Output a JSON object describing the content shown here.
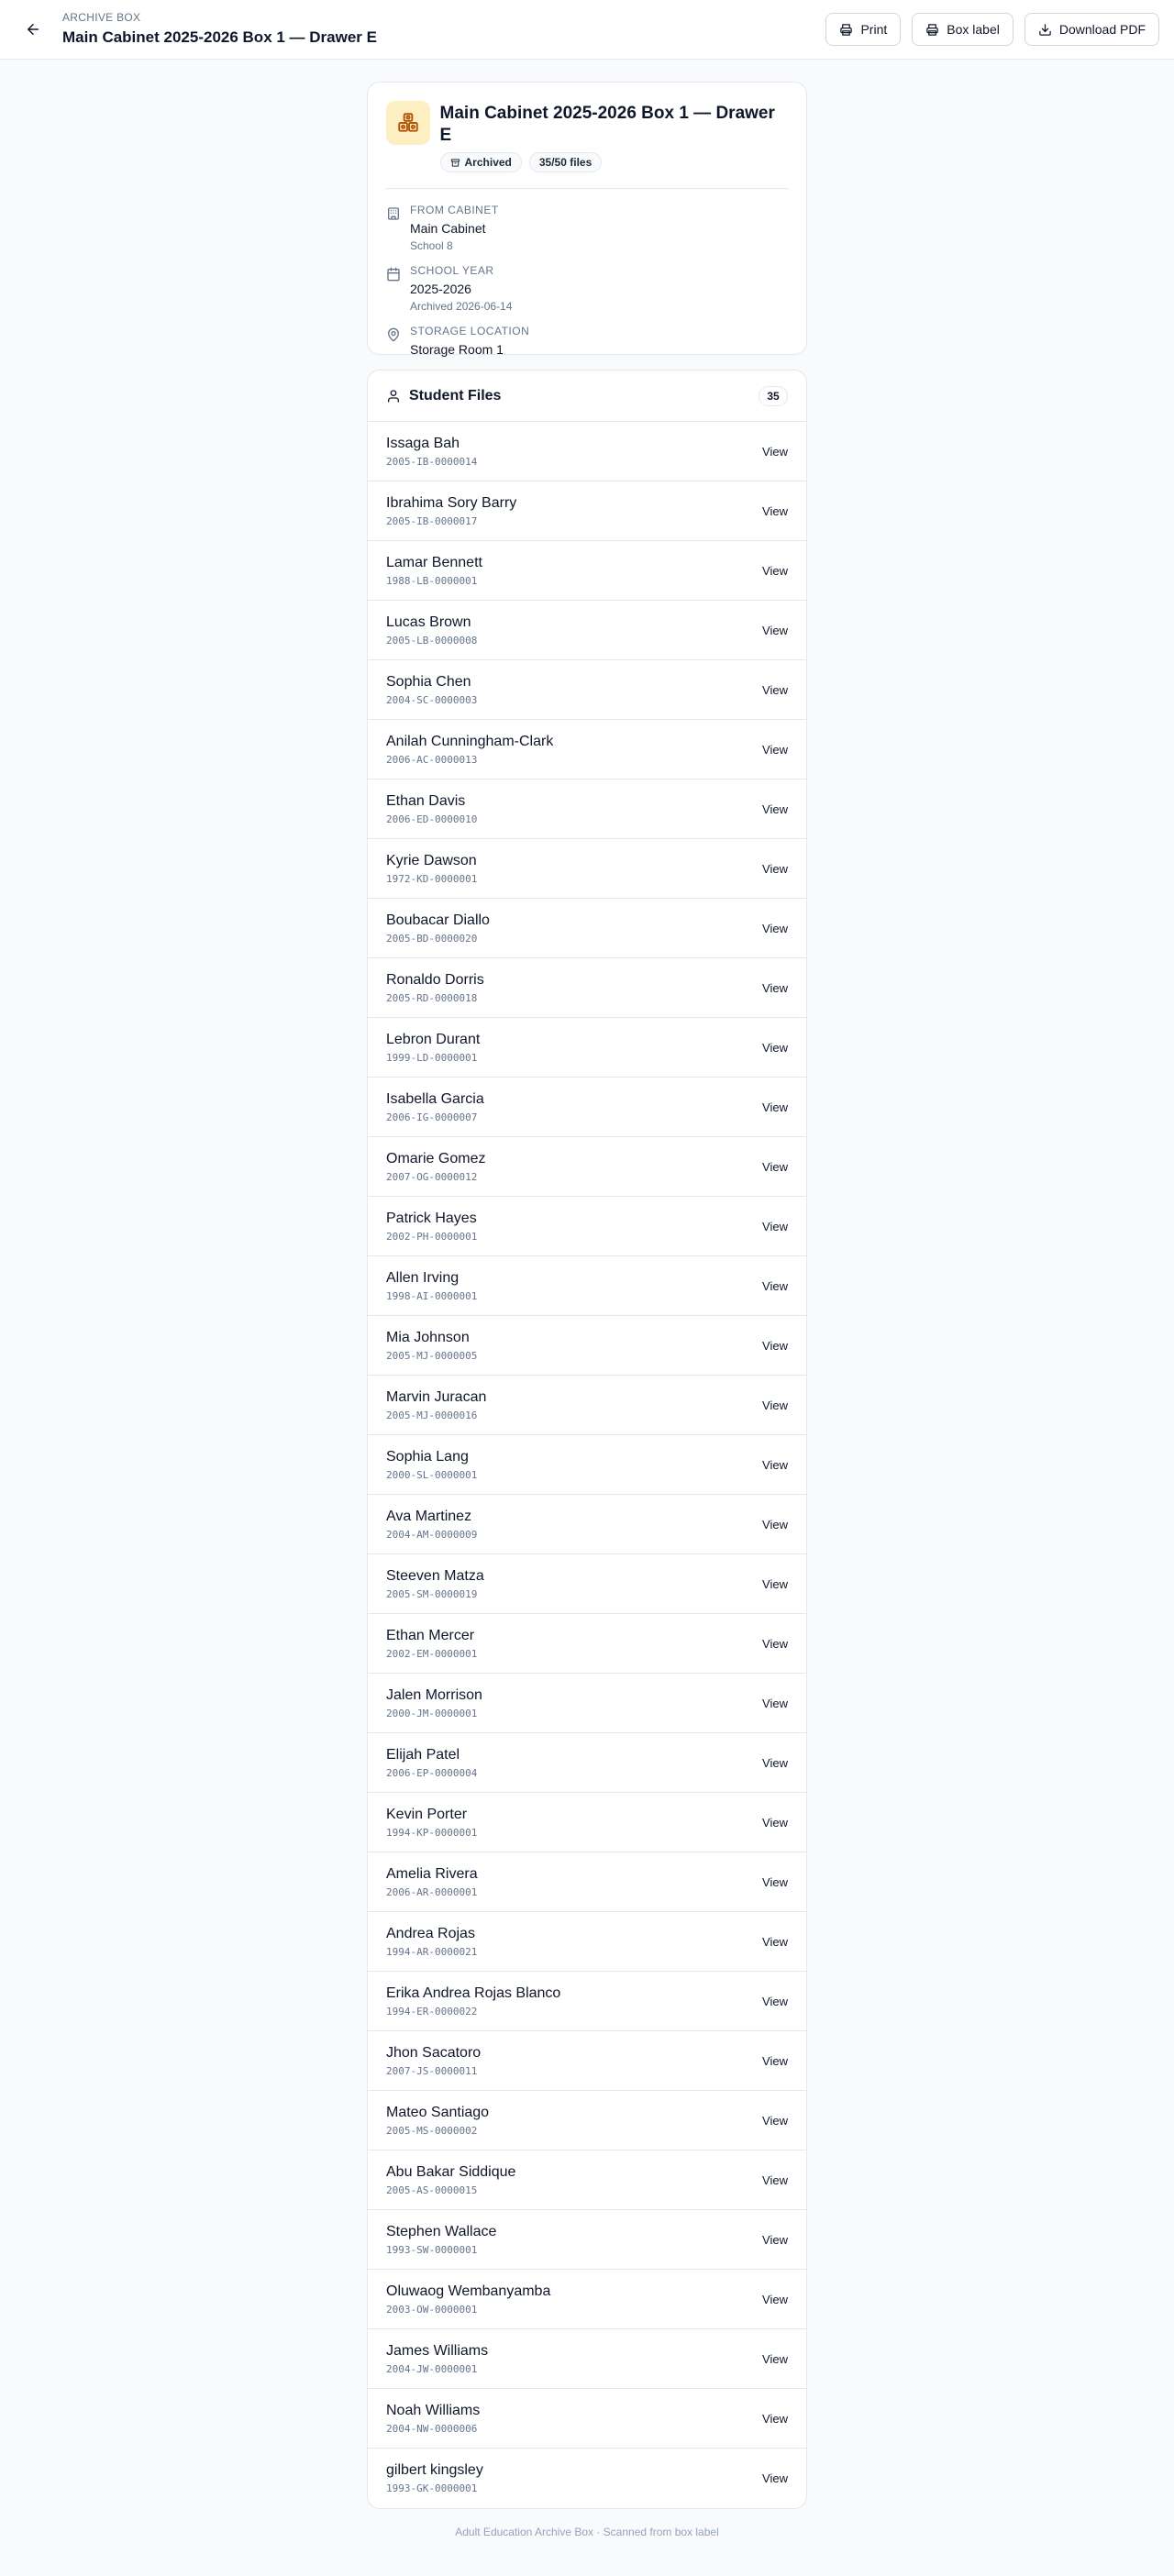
{
  "header": {
    "eyebrow": "ARCHIVE BOX",
    "title": "Main Cabinet 2025-2026 Box 1 — Drawer E",
    "actions": {
      "print": "Print",
      "box_label": "Box label",
      "download_pdf": "Download PDF"
    }
  },
  "box": {
    "title": "Main Cabinet 2025-2026 Box 1 — Drawer E",
    "status_badge": "Archived",
    "files_badge": "35/50 files",
    "meta": {
      "cabinet": {
        "label": "FROM CABINET",
        "value": "Main Cabinet",
        "sub": "School 8"
      },
      "year": {
        "label": "SCHOOL YEAR",
        "value": "2025-2026",
        "sub": "Archived 2026-06-14"
      },
      "location": {
        "label": "STORAGE LOCATION",
        "value": "Storage Room 1"
      }
    }
  },
  "files": {
    "title": "Student Files",
    "count": "35",
    "view_label": "View",
    "items": [
      {
        "name": "Issaga Bah",
        "id": "2005-IB-0000014"
      },
      {
        "name": "Ibrahima Sory Barry",
        "id": "2005-IB-0000017"
      },
      {
        "name": "Lamar Bennett",
        "id": "1988-LB-0000001"
      },
      {
        "name": "Lucas Brown",
        "id": "2005-LB-0000008"
      },
      {
        "name": "Sophia Chen",
        "id": "2004-SC-0000003"
      },
      {
        "name": "Anilah Cunningham-Clark",
        "id": "2006-AC-0000013"
      },
      {
        "name": "Ethan Davis",
        "id": "2006-ED-0000010"
      },
      {
        "name": "Kyrie Dawson",
        "id": "1972-KD-0000001"
      },
      {
        "name": "Boubacar Diallo",
        "id": "2005-BD-0000020"
      },
      {
        "name": "Ronaldo Dorris",
        "id": "2005-RD-0000018"
      },
      {
        "name": "Lebron Durant",
        "id": "1999-LD-0000001"
      },
      {
        "name": "Isabella Garcia",
        "id": "2006-IG-0000007"
      },
      {
        "name": "Omarie Gomez",
        "id": "2007-OG-0000012"
      },
      {
        "name": "Patrick Hayes",
        "id": "2002-PH-0000001"
      },
      {
        "name": "Allen Irving",
        "id": "1998-AI-0000001"
      },
      {
        "name": "Mia Johnson",
        "id": "2005-MJ-0000005"
      },
      {
        "name": "Marvin Juracan",
        "id": "2005-MJ-0000016"
      },
      {
        "name": "Sophia Lang",
        "id": "2000-SL-0000001"
      },
      {
        "name": "Ava Martinez",
        "id": "2004-AM-0000009"
      },
      {
        "name": "Steeven Matza",
        "id": "2005-SM-0000019"
      },
      {
        "name": "Ethan Mercer",
        "id": "2002-EM-0000001"
      },
      {
        "name": "Jalen Morrison",
        "id": "2000-JM-0000001"
      },
      {
        "name": "Elijah Patel",
        "id": "2006-EP-0000004"
      },
      {
        "name": "Kevin Porter",
        "id": "1994-KP-0000001"
      },
      {
        "name": "Amelia Rivera",
        "id": "2006-AR-0000001"
      },
      {
        "name": "Andrea Rojas",
        "id": "1994-AR-0000021"
      },
      {
        "name": "Erika Andrea Rojas Blanco",
        "id": "1994-ER-0000022"
      },
      {
        "name": "Jhon Sacatoro",
        "id": "2007-JS-0000011"
      },
      {
        "name": "Mateo Santiago",
        "id": "2005-MS-0000002"
      },
      {
        "name": "Abu Bakar Siddique",
        "id": "2005-AS-0000015"
      },
      {
        "name": "Stephen Wallace",
        "id": "1993-SW-0000001"
      },
      {
        "name": "Oluwaog Wembanyamba",
        "id": "2003-OW-0000001"
      },
      {
        "name": "James Williams",
        "id": "2004-JW-0000001"
      },
      {
        "name": "Noah Williams",
        "id": "2004-NW-0000006"
      },
      {
        "name": "gilbert kingsley",
        "id": "1993-GK-0000001"
      }
    ]
  },
  "footer": "Adult Education Archive Box · Scanned from box label"
}
